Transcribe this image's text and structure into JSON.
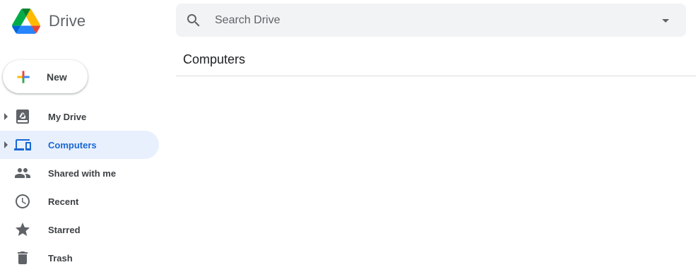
{
  "app": {
    "name": "Drive"
  },
  "search": {
    "placeholder": "Search Drive"
  },
  "new_button": {
    "label": "New"
  },
  "sidebar": {
    "items": [
      {
        "label": "My Drive",
        "icon": "my-drive-icon",
        "active": false,
        "expandable": true
      },
      {
        "label": "Computers",
        "icon": "computers-icon",
        "active": true,
        "expandable": true
      },
      {
        "label": "Shared with me",
        "icon": "shared-icon",
        "active": false,
        "expandable": false
      },
      {
        "label": "Recent",
        "icon": "clock-icon",
        "active": false,
        "expandable": false
      },
      {
        "label": "Starred",
        "icon": "star-icon",
        "active": false,
        "expandable": false
      },
      {
        "label": "Trash",
        "icon": "trash-icon",
        "active": false,
        "expandable": false
      }
    ]
  },
  "main": {
    "title": "Computers"
  },
  "colors": {
    "accent": "#1967d2",
    "active_bg": "#e8f0fe",
    "search_bg": "#f1f3f4",
    "icon_gray": "#5f6368"
  }
}
